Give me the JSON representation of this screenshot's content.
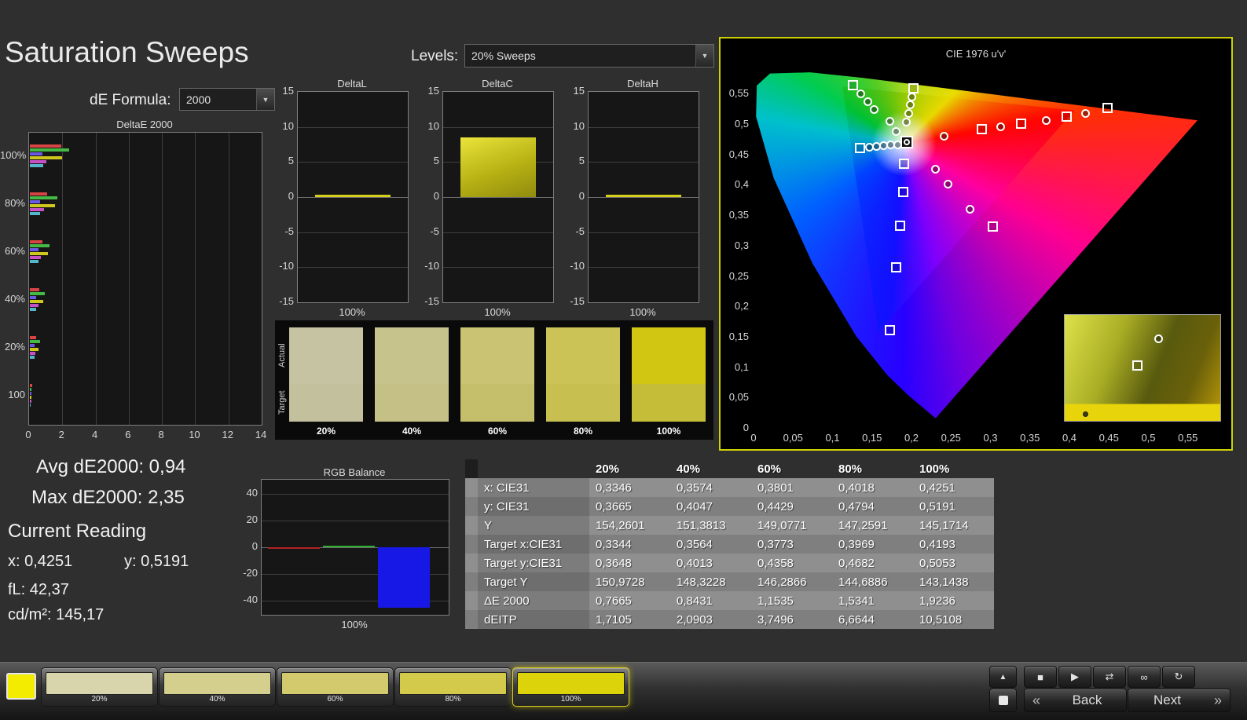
{
  "app": {
    "title": "Saturation Sweeps",
    "de_formula_label": "dE Formula:",
    "de_formula_value": "2000",
    "levels_label": "Levels:",
    "levels_value": "20% Sweeps",
    "dropdown_arrow": "▼"
  },
  "charts": {
    "deltaE": {
      "title": "DeltaE 2000",
      "x_ticks": [
        "0",
        "2",
        "4",
        "6",
        "8",
        "10",
        "12",
        "14"
      ],
      "x_max": 14,
      "groups": [
        {
          "label": "100%",
          "bars": [
            {
              "c": "#d84444",
              "v": 1.9
            },
            {
              "c": "#44b944",
              "v": 2.35
            },
            {
              "c": "#6a5ae0",
              "v": 0.75
            },
            {
              "c": "#cfc61e",
              "v": 1.95
            },
            {
              "c": "#c650c6",
              "v": 1.0
            },
            {
              "c": "#55b5c9",
              "v": 0.8
            }
          ]
        },
        {
          "label": "80%",
          "bars": [
            {
              "c": "#d84444",
              "v": 1.05
            },
            {
              "c": "#44b944",
              "v": 1.65
            },
            {
              "c": "#6a5ae0",
              "v": 0.6
            },
            {
              "c": "#cfc61e",
              "v": 1.5
            },
            {
              "c": "#c650c6",
              "v": 0.85
            },
            {
              "c": "#55b5c9",
              "v": 0.6
            }
          ]
        },
        {
          "label": "60%",
          "bars": [
            {
              "c": "#d84444",
              "v": 0.75
            },
            {
              "c": "#44b944",
              "v": 1.2
            },
            {
              "c": "#6a5ae0",
              "v": 0.5
            },
            {
              "c": "#cfc61e",
              "v": 1.1
            },
            {
              "c": "#c650c6",
              "v": 0.65
            },
            {
              "c": "#55b5c9",
              "v": 0.5
            }
          ]
        },
        {
          "label": "40%",
          "bars": [
            {
              "c": "#d84444",
              "v": 0.55
            },
            {
              "c": "#44b944",
              "v": 0.9
            },
            {
              "c": "#6a5ae0",
              "v": 0.4
            },
            {
              "c": "#cfc61e",
              "v": 0.8
            },
            {
              "c": "#c650c6",
              "v": 0.5
            },
            {
              "c": "#55b5c9",
              "v": 0.4
            }
          ]
        },
        {
          "label": "20%",
          "bars": [
            {
              "c": "#d84444",
              "v": 0.4
            },
            {
              "c": "#44b944",
              "v": 0.6
            },
            {
              "c": "#6a5ae0",
              "v": 0.3
            },
            {
              "c": "#cfc61e",
              "v": 0.5
            },
            {
              "c": "#c650c6",
              "v": 0.35
            },
            {
              "c": "#55b5c9",
              "v": 0.3
            }
          ]
        },
        {
          "label": "100",
          "bars": [
            {
              "c": "#d84444",
              "v": 0.12
            },
            {
              "c": "#44b944",
              "v": 0.1
            },
            {
              "c": "#6a5ae0",
              "v": 0.08
            },
            {
              "c": "#cfc61e",
              "v": 0.1
            },
            {
              "c": "#c650c6",
              "v": 0.08
            },
            {
              "c": "#55b5c9",
              "v": 0.06
            }
          ]
        }
      ]
    },
    "mini_y_ticks": [
      "15",
      "10",
      "5",
      "0",
      "-5",
      "-10",
      "-15"
    ],
    "mini": [
      {
        "title": "DeltaL",
        "value": 0.3,
        "x_label": "100%"
      },
      {
        "title": "DeltaC",
        "value": 8.5,
        "x_label": "100%"
      },
      {
        "title": "DeltaH",
        "value": 0.15,
        "x_label": "100%"
      }
    ],
    "rgb": {
      "title": "RGB Balance",
      "x_label": "100%",
      "y_ticks": [
        "40",
        "20",
        "0",
        "-20",
        "-40"
      ],
      "bars": [
        {
          "name": "red",
          "c": "#b22222",
          "v": -0.3
        },
        {
          "name": "green",
          "c": "#2fae2f",
          "v": 1.0
        },
        {
          "name": "blue",
          "c": "#1818e6",
          "v": -45
        }
      ]
    }
  },
  "swatches": {
    "actual_label": "Actual",
    "target_label": "Target",
    "items": [
      {
        "label": "20%",
        "actual": "#c6c3a3",
        "target": "#c3c09e"
      },
      {
        "label": "40%",
        "actual": "#c7c38c",
        "target": "#c4c086"
      },
      {
        "label": "60%",
        "actual": "#c9c373",
        "target": "#c5bf6c"
      },
      {
        "label": "80%",
        "actual": "#cbc355",
        "target": "#c7bf4f"
      },
      {
        "label": "100%",
        "actual": "#d1c713",
        "target": "#c5bc38"
      }
    ]
  },
  "cie": {
    "title": "CIE 1976 u'v'",
    "x_ticks": [
      "0",
      "0,05",
      "0,1",
      "0,15",
      "0,2",
      "0,25",
      "0,3",
      "0,35",
      "0,4",
      "0,45",
      "0,5",
      "0,55"
    ],
    "y_ticks": [
      "0",
      "0,05",
      "0,1",
      "0,15",
      "0,2",
      "0,25",
      "0,3",
      "0,35",
      "0,4",
      "0,45",
      "0,5",
      "0,55"
    ],
    "markers": [
      {
        "t": "sq",
        "u": 0.125,
        "v": 0.565
      },
      {
        "t": "c",
        "u": 0.135,
        "v": 0.55
      },
      {
        "t": "c",
        "u": 0.144,
        "v": 0.538
      },
      {
        "t": "c",
        "u": 0.152,
        "v": 0.525
      },
      {
        "t": "c",
        "u": 0.172,
        "v": 0.505
      },
      {
        "t": "c",
        "u": 0.18,
        "v": 0.489
      },
      {
        "t": "sq",
        "u": 0.202,
        "v": 0.559
      },
      {
        "t": "c",
        "u": 0.2,
        "v": 0.545
      },
      {
        "t": "c",
        "u": 0.198,
        "v": 0.532
      },
      {
        "t": "c",
        "u": 0.196,
        "v": 0.518
      },
      {
        "t": "c",
        "u": 0.193,
        "v": 0.504
      },
      {
        "t": "sq",
        "u": 0.134,
        "v": 0.461
      },
      {
        "t": "c",
        "u": 0.146,
        "v": 0.462
      },
      {
        "t": "c",
        "u": 0.155,
        "v": 0.464
      },
      {
        "t": "c",
        "u": 0.164,
        "v": 0.465
      },
      {
        "t": "c",
        "u": 0.173,
        "v": 0.466
      },
      {
        "t": "c",
        "u": 0.182,
        "v": 0.467
      },
      {
        "t": "cur",
        "u": 0.194,
        "v": 0.47
      },
      {
        "t": "sq",
        "u": 0.448,
        "v": 0.527
      },
      {
        "t": "c",
        "u": 0.42,
        "v": 0.518
      },
      {
        "t": "sq",
        "u": 0.396,
        "v": 0.513
      },
      {
        "t": "c",
        "u": 0.37,
        "v": 0.507
      },
      {
        "t": "sq",
        "u": 0.338,
        "v": 0.501
      },
      {
        "t": "c",
        "u": 0.312,
        "v": 0.496
      },
      {
        "t": "sq",
        "u": 0.289,
        "v": 0.492
      },
      {
        "t": "c",
        "u": 0.241,
        "v": 0.48
      },
      {
        "t": "sq",
        "u": 0.19,
        "v": 0.436
      },
      {
        "t": "c",
        "u": 0.23,
        "v": 0.426
      },
      {
        "t": "sq",
        "u": 0.189,
        "v": 0.389
      },
      {
        "t": "c",
        "u": 0.246,
        "v": 0.402
      },
      {
        "t": "sq",
        "u": 0.185,
        "v": 0.333
      },
      {
        "t": "c",
        "u": 0.274,
        "v": 0.36
      },
      {
        "t": "sq",
        "u": 0.302,
        "v": 0.332
      },
      {
        "t": "sq",
        "u": 0.18,
        "v": 0.265
      },
      {
        "t": "sq",
        "u": 0.172,
        "v": 0.161
      }
    ],
    "inset_markers": [
      {
        "t": "c",
        "x": 0.6,
        "y": 0.22
      },
      {
        "t": "sq",
        "x": 0.46,
        "y": 0.47
      },
      {
        "t": "dot",
        "x": 0.14,
        "y": 0.95
      }
    ]
  },
  "stats": {
    "avg": "Avg dE2000: 0,94",
    "max": "Max dE2000: 2,35",
    "current_title": "Current Reading",
    "x": "x: 0,4251",
    "y": "y: 0,5191",
    "fl": "fL: 42,37",
    "cd": "cd/m²: 145,17"
  },
  "table": {
    "headers": [
      "20%",
      "40%",
      "60%",
      "80%",
      "100%"
    ],
    "rows": [
      {
        "label": "x: CIE31",
        "values": [
          "0,3346",
          "0,3574",
          "0,3801",
          "0,4018",
          "0,4251"
        ]
      },
      {
        "label": "y: CIE31",
        "values": [
          "0,3665",
          "0,4047",
          "0,4429",
          "0,4794",
          "0,5191"
        ]
      },
      {
        "label": "Y",
        "values": [
          "154,2601",
          "151,3813",
          "149,0771",
          "147,2591",
          "145,1714"
        ]
      },
      {
        "label": "Target x:CIE31",
        "values": [
          "0,3344",
          "0,3564",
          "0,3773",
          "0,3969",
          "0,4193"
        ]
      },
      {
        "label": "Target y:CIE31",
        "values": [
          "0,3648",
          "0,4013",
          "0,4358",
          "0,4682",
          "0,5053"
        ]
      },
      {
        "label": "Target Y",
        "values": [
          "150,9728",
          "148,3228",
          "146,2866",
          "144,6886",
          "143,1438"
        ]
      },
      {
        "label": "ΔE 2000",
        "values": [
          "0,7665",
          "0,8431",
          "1,1535",
          "1,5341",
          "1,9236"
        ]
      },
      {
        "label": "dEITP",
        "values": [
          "1,7105",
          "2,0903",
          "3,7496",
          "6,6644",
          "10,5108"
        ]
      }
    ]
  },
  "toolbar": {
    "indicator_color": "#f3eb00",
    "patterns": [
      {
        "label": "20%",
        "color": "#d8d4ab"
      },
      {
        "label": "40%",
        "color": "#d5cf8e"
      },
      {
        "label": "60%",
        "color": "#d2ca6d"
      },
      {
        "label": "80%",
        "color": "#d3ca4c"
      },
      {
        "label": "100%",
        "color": "#ddd30b",
        "selected": true
      }
    ],
    "up_glyph": "▲",
    "display_icon": "white-square",
    "transport": [
      {
        "name": "stop",
        "glyph": "■"
      },
      {
        "name": "play",
        "glyph": "▶"
      },
      {
        "name": "step",
        "glyph": "⇄"
      },
      {
        "name": "loop",
        "glyph": "∞"
      },
      {
        "name": "refresh",
        "glyph": "↻"
      }
    ],
    "back": "Back",
    "next": "Next",
    "back_icon": "«",
    "next_icon": "»"
  }
}
